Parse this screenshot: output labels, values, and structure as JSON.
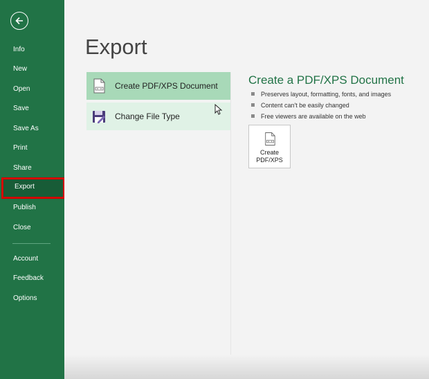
{
  "sidebar": {
    "items": [
      {
        "label": "Info"
      },
      {
        "label": "New"
      },
      {
        "label": "Open"
      },
      {
        "label": "Save"
      },
      {
        "label": "Save As"
      },
      {
        "label": "Print"
      },
      {
        "label": "Share"
      },
      {
        "label": "Export"
      },
      {
        "label": "Publish"
      },
      {
        "label": "Close"
      },
      {
        "label": "Account"
      },
      {
        "label": "Feedback"
      },
      {
        "label": "Options"
      }
    ],
    "active_item": "Export"
  },
  "main": {
    "title": "Export",
    "options": [
      {
        "label": "Create PDF/XPS Document"
      },
      {
        "label": "Change File Type"
      }
    ]
  },
  "detail": {
    "title": "Create a PDF/XPS Document",
    "bullets": [
      "Preserves layout, formatting, fonts, and images",
      "Content can't be easily changed",
      "Free viewers are available on the web"
    ],
    "button_label_line1": "Create",
    "button_label_line2": "PDF/XPS"
  },
  "colors": {
    "sidebar": "#217346",
    "active_item_bg": "#185c37",
    "highlight_box": "#d40000",
    "selected_option": "#a8d9b8",
    "hover_option": "#e0f2e6",
    "accent_text": "#217346"
  }
}
